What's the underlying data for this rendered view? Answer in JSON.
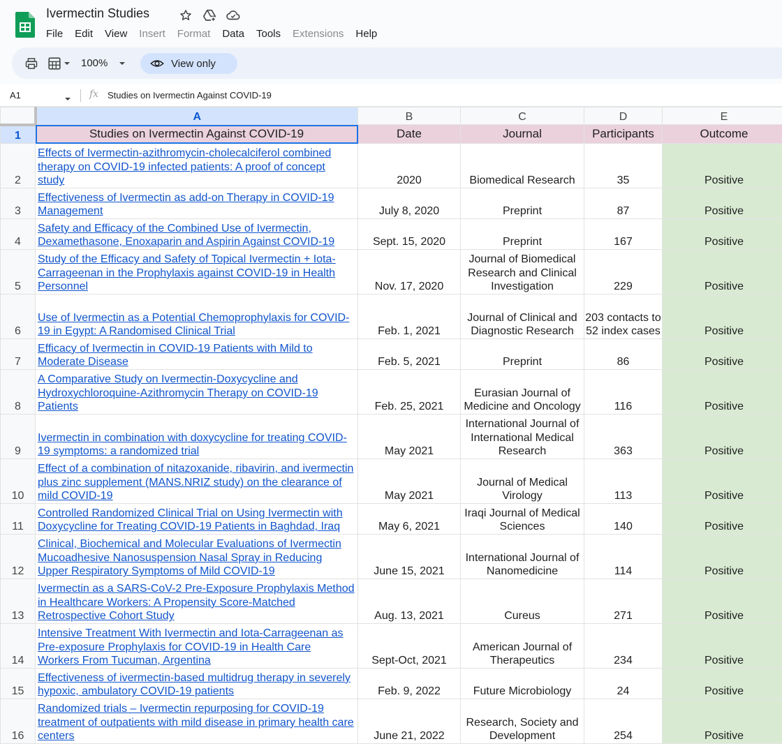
{
  "doc": {
    "title": "Ivermectin Studies"
  },
  "menu": [
    "File",
    "Edit",
    "View",
    "Insert",
    "Format",
    "Data",
    "Tools",
    "Extensions",
    "Help"
  ],
  "toolbar": {
    "zoom": "100%",
    "view_only": "View only"
  },
  "formula_bar": {
    "cell_ref": "A1",
    "fx": "fx",
    "content": "Studies on Ivermectin Against COVID-19"
  },
  "columns": [
    "A",
    "B",
    "C",
    "D",
    "E"
  ],
  "header_row": {
    "row": "1",
    "cells": [
      "Studies on Ivermectin Against COVID-19",
      "Date",
      "Journal",
      "Participants",
      "Outcome"
    ]
  },
  "rows": [
    {
      "n": "2",
      "title": "Effects of Ivermectin-azithromycin-cholecalciferol combined therapy on COVID-19 infected patients: A proof of concept study",
      "date": "2020",
      "journal": "Biomedical Research",
      "participants": "35",
      "outcome": "Positive"
    },
    {
      "n": "3",
      "title": "Effectiveness of Ivermectin as add-on Therapy in COVID-19 Management",
      "date": "July 8, 2020",
      "journal": "Preprint",
      "participants": "87",
      "outcome": "Positive"
    },
    {
      "n": "4",
      "title": "Safety and Efficacy of the Combined Use of Ivermectin, Dexamethasone, Enoxaparin and Aspirin Against COVID-19",
      "date": "Sept. 15, 2020",
      "journal": "Preprint",
      "participants": "167",
      "outcome": "Positive"
    },
    {
      "n": "5",
      "title": "Study of the Efficacy and Safety of Topical Ivermectin + Iota-Carrageenan in the Prophylaxis against COVID-19 in Health Personnel",
      "date": "Nov. 17, 2020",
      "journal": "Journal of Biomedical Research and Clinical Investigation",
      "participants": "229",
      "outcome": "Positive"
    },
    {
      "n": "6",
      "title": "Use of Ivermectin as a Potential Chemoprophylaxis for COVID-19 in Egypt: A Randomised Clinical Trial",
      "date": "Feb. 1, 2021",
      "journal": "Journal of Clinical and Diagnostic Research",
      "participants": "203 contacts to 52 index cases",
      "outcome": "Positive"
    },
    {
      "n": "7",
      "title": "Efficacy of Ivermectin in COVID-19 Patients with Mild to Moderate Disease",
      "date": "Feb. 5, 2021",
      "journal": "Preprint",
      "participants": "86",
      "outcome": "Positive"
    },
    {
      "n": "8",
      "title": "A Comparative Study on Ivermectin-Doxycycline and Hydroxychloroquine-Azithromycin Therapy on COVID-19 Patients",
      "date": "Feb. 25, 2021",
      "journal": "Eurasian Journal of Medicine and Oncology",
      "participants": "116",
      "outcome": "Positive"
    },
    {
      "n": "9",
      "title": "Ivermectin in combination with doxycycline for treating COVID-19 symptoms: a randomized trial",
      "date": "May 2021",
      "journal": "International Journal of International Medical Research",
      "participants": "363",
      "outcome": "Positive"
    },
    {
      "n": "10",
      "title": "Effect of a combination of nitazoxanide, ribavirin, and ivermectin plus zinc supplement (MANS.NRIZ study) on the clearance of mild COVID-19",
      "date": "May 2021",
      "journal": "Journal of Medical Virology",
      "participants": "113",
      "outcome": "Positive"
    },
    {
      "n": "11",
      "title": "Controlled Randomized Clinical Trial on Using Ivermectin with Doxycycline for Treating COVID-19 Patients in Baghdad, Iraq",
      "date": "May 6, 2021",
      "journal": "Iraqi Journal of Medical Sciences",
      "participants": "140",
      "outcome": "Positive"
    },
    {
      "n": "12",
      "title": "Clinical, Biochemical and Molecular Evaluations of Ivermectin Mucoadhesive Nanosuspension Nasal Spray in Reducing Upper Respiratory Symptoms of Mild COVID-19",
      "date": "June 15, 2021",
      "journal": "International Journal of Nanomedicine",
      "participants": "114",
      "outcome": "Positive"
    },
    {
      "n": "13",
      "title": "Ivermectin as a SARS-CoV-2 Pre-Exposure Prophylaxis Method in Healthcare Workers: A Propensity Score-Matched Retrospective Cohort Study",
      "date": "Aug. 13, 2021",
      "journal": "Cureus",
      "participants": "271",
      "outcome": "Positive"
    },
    {
      "n": "14",
      "title": "Intensive Treatment With Ivermectin and Iota-Carrageenan as Pre-exposure Prophylaxis for COVID-19 in Health Care Workers From Tucuman, Argentina",
      "date": "Sept-Oct, 2021",
      "journal": "American Journal of Therapeutics",
      "participants": "234",
      "outcome": "Positive"
    },
    {
      "n": "15",
      "title": "Effectiveness of ivermectin-based multidrug therapy in severely hypoxic, ambulatory COVID-19 patients",
      "date": "Feb. 9, 2022",
      "journal": "Future Microbiology",
      "participants": "24",
      "outcome": "Positive"
    },
    {
      "n": "16",
      "title": "Randomized trials – Ivermectin repurposing for COVID-19 treatment of outpatients with mild disease in primary health care centers",
      "date": "June 21, 2022",
      "journal": "Research, Society and Development",
      "participants": "254",
      "outcome": "Positive"
    }
  ]
}
